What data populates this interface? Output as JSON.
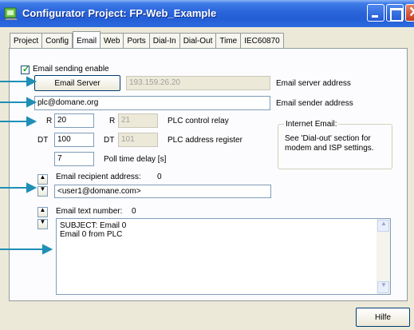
{
  "window": {
    "title": "Configurator Project: FP-Web_Example"
  },
  "tabs": [
    "Project",
    "Config",
    "Email",
    "Web",
    "Ports",
    "Dial-In",
    "Dial-Out",
    "Time",
    "IEC60870"
  ],
  "active_tab": "Email",
  "email": {
    "enable_label": "Email sending enable",
    "enabled": true,
    "server_button": "Email Server",
    "server_address": "193.159.26.20",
    "server_address_label": "Email server address",
    "sender_address": "plc@domane.org",
    "sender_address_label": "Email sender address",
    "relay_prefix": "R",
    "relay_value": "20",
    "relay_prefix_2": "R",
    "relay_value_2": "21",
    "relay_label": "PLC control relay",
    "register_prefix": "DT",
    "register_value": "100",
    "register_prefix_2": "DT",
    "register_value_2": "101",
    "register_label": "PLC address register",
    "poll_value": "7",
    "poll_label": "Poll time delay [s]",
    "recipient_label": "Email recipient address:",
    "recipient_index": "0",
    "recipient_value": "<user1@domane.com>",
    "text_number_label": "Email text number:",
    "text_number_index": "0",
    "text_line_1": "SUBJECT: Email 0",
    "text_line_2": "Email 0 from PLC"
  },
  "internet_email": {
    "legend": "Internet Email:",
    "line_1": "See 'Dial-out' section for",
    "line_2": "modem and ISP settings."
  },
  "footer": {
    "help_button": "Hilfe"
  },
  "colors": {
    "arrow": "#1f8fb5",
    "title_bar": "#245ed6"
  }
}
